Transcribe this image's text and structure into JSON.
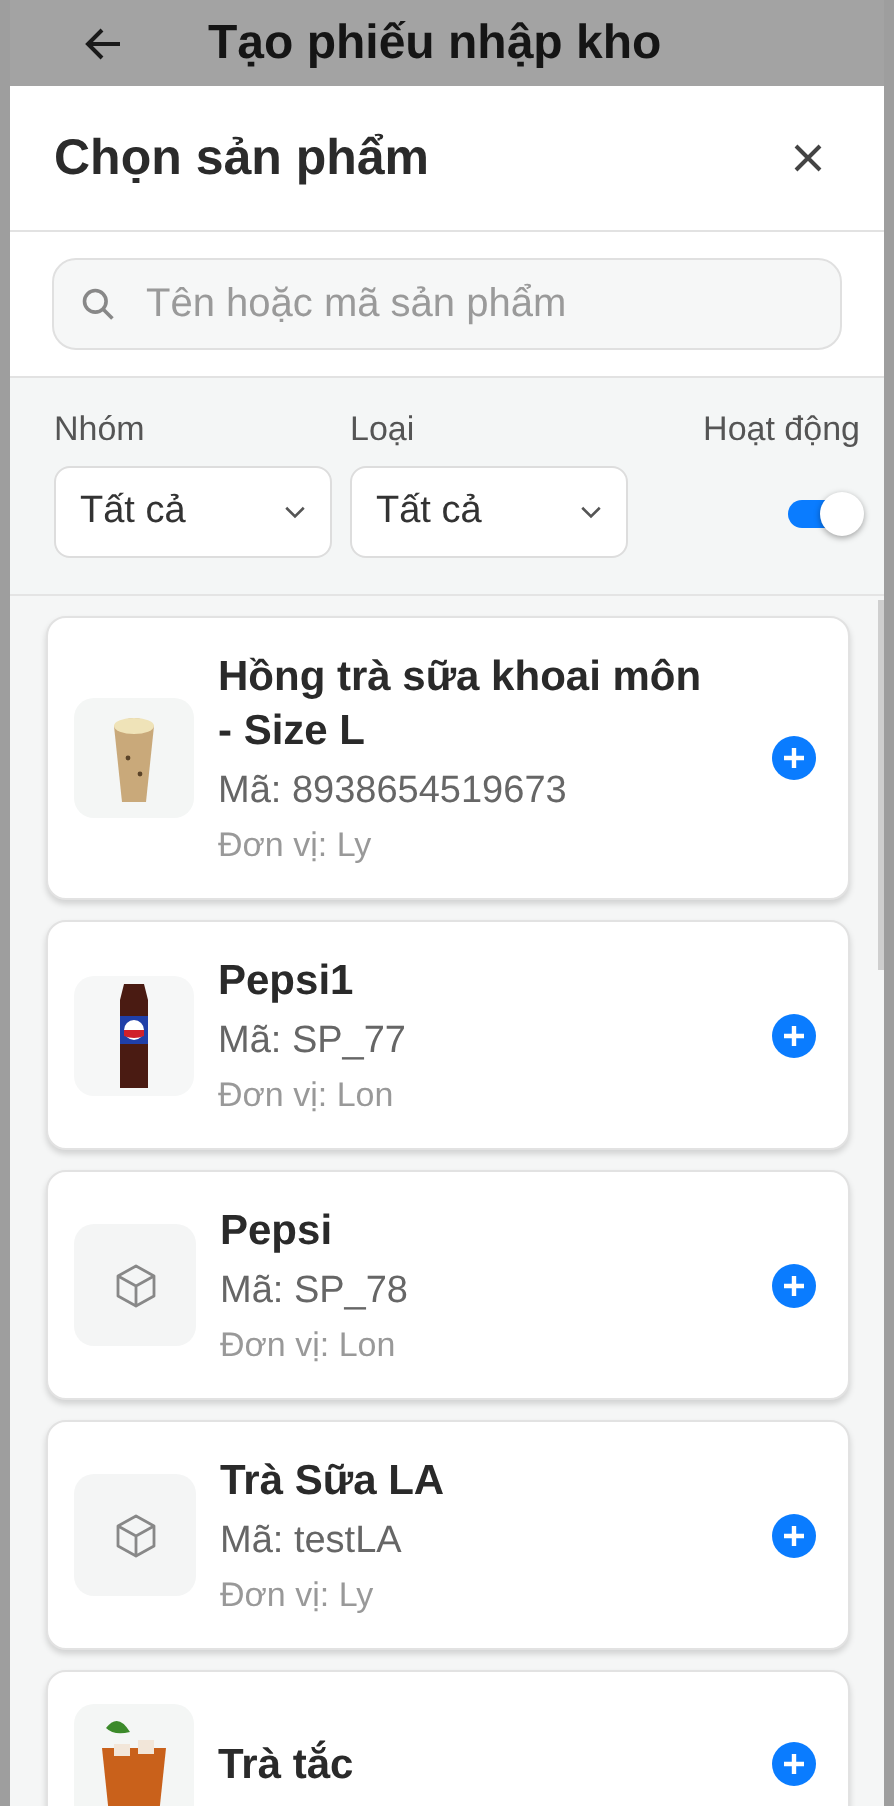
{
  "app_bar": {
    "title": "Tạo phiếu nhập kho"
  },
  "sheet": {
    "title": "Chọn sản phẩm"
  },
  "search": {
    "placeholder": "Tên hoặc mã sản phẩm"
  },
  "filters": [
    {
      "label": "Nhóm",
      "value": "Tất cả"
    },
    {
      "label": "Loại",
      "value": "Tất cả"
    }
  ],
  "active_toggle": {
    "label": "Hoạt động",
    "on": true
  },
  "products": [
    {
      "name": "Hồng trà sữa khoai môn - Size L",
      "code": "Mã: 8938654519673",
      "unit": "Đơn vị: Ly",
      "image": {
        "kind": "cup"
      }
    },
    {
      "name": "Pepsi1",
      "code": "Mã: SP_77",
      "unit": "Đơn vị: Lon",
      "image": {
        "kind": "bottle"
      }
    },
    {
      "name": "Pepsi",
      "code": "Mã: SP_78",
      "unit": "Đơn vị: Lon",
      "image": {
        "kind": "placeholder"
      }
    },
    {
      "name": "Trà Sữa LA",
      "code": "Mã: testLA",
      "unit": "Đơn vị: Ly",
      "image": {
        "kind": "placeholder"
      }
    },
    {
      "name": "Trà tắc",
      "image": {
        "kind": "glass"
      }
    }
  ]
}
